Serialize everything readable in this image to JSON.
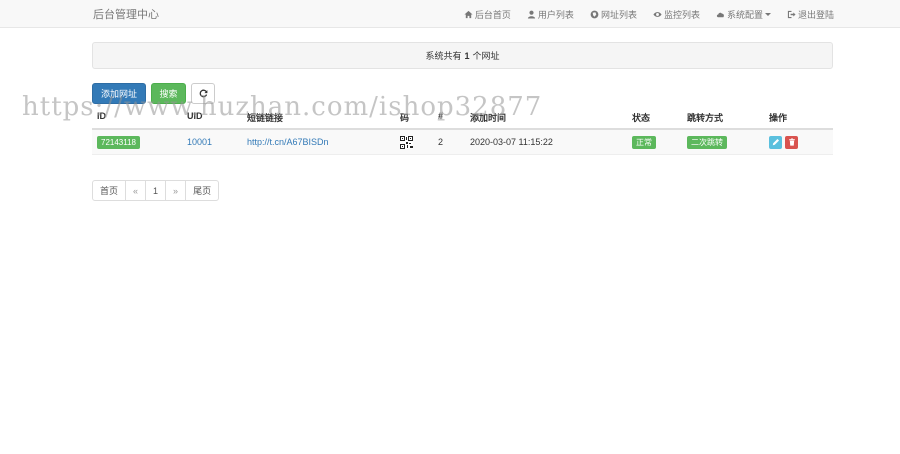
{
  "nav": {
    "brand": "后台管理中心",
    "items": [
      {
        "label": "后台首页",
        "icon": "home-icon"
      },
      {
        "label": "用户列表",
        "icon": "user-icon"
      },
      {
        "label": "网址列表",
        "icon": "globe-icon"
      },
      {
        "label": "监控列表",
        "icon": "eye-icon"
      },
      {
        "label": "系统配置",
        "icon": "cloud-icon"
      },
      {
        "label": "退出登陆",
        "icon": "logout-icon"
      }
    ]
  },
  "summary": {
    "prefix": "系统共有",
    "count": "1",
    "suffix": "个网址"
  },
  "toolbar": {
    "add_label": "添加网址",
    "search_label": "搜索",
    "refresh_icon": "refresh-icon"
  },
  "table": {
    "headers": [
      "ID",
      "UID",
      "短链链接",
      "码",
      "#",
      "添加时间",
      "状态",
      "跳转方式",
      "操作"
    ],
    "rows": [
      {
        "id": "72143118",
        "uid": "10001",
        "short_url": "http://t.cn/A67BISDn",
        "count": "2",
        "added_time": "2020-03-07 11:15:22",
        "status": "正常",
        "redirect": "二次跳转"
      }
    ]
  },
  "pager": {
    "first": "首页",
    "prev": "«",
    "page": "1",
    "next": "»",
    "last": "尾页"
  },
  "watermark": "https://www.huzhan.com/ishop32877",
  "colors": {
    "primary": "#337ab7",
    "success": "#5cb85c",
    "info": "#5bc0de",
    "danger": "#d9534f"
  }
}
